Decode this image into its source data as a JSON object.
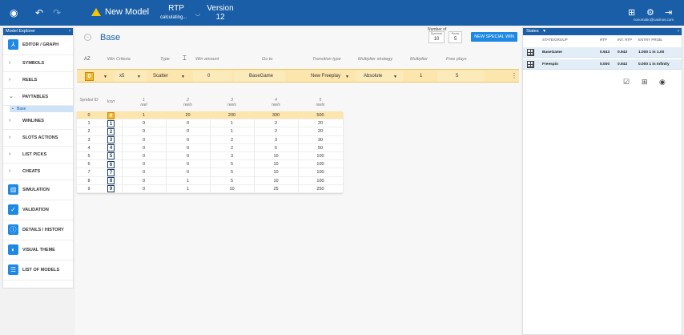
{
  "topbar": {
    "title": "New Model",
    "rtp_label": "RTP",
    "rtp_status": "calculating...",
    "version_label": "Version",
    "version_number": "12",
    "email": "novomatic@casinos.com",
    "icons": [
      "play-circle-icon",
      "undo-icon",
      "redo-icon",
      "warning-icon",
      "grid-menu-icon",
      "gear-icon",
      "logout-icon"
    ]
  },
  "sidebar": {
    "header": "Model Explorer",
    "items": [
      {
        "label": "EDITOR / GRAPH",
        "icon": "graph-icon"
      },
      {
        "label": "SYMBOLS"
      },
      {
        "label": "REELS"
      },
      {
        "label": "PAYTABLES",
        "sub": "Base"
      },
      {
        "label": "WINLINES"
      },
      {
        "label": "SLOTS ACTIONS"
      },
      {
        "label": "LIST PICKS"
      },
      {
        "label": "CHEATS"
      },
      {
        "label": "SIMULATION",
        "icon": "chart-icon"
      },
      {
        "label": "VALIDATION",
        "icon": "check-icon"
      },
      {
        "label": "DETAILS / HISTORY",
        "icon": "info-icon"
      },
      {
        "label": "VISUAL THEME",
        "icon": "palette-icon"
      },
      {
        "label": "LIST OF MODELS",
        "icon": "list-icon"
      }
    ]
  },
  "main": {
    "title": "Base",
    "number_of": "Number of",
    "symbols_caption": "Symbols",
    "symbols_value": "10",
    "reels_caption": "Reels",
    "reels_value": "5",
    "new_special_win": "NEW SPECIAL WIN",
    "rule_headers": {
      "az": "AZ",
      "win_criteria": "Win Criteria",
      "type": "Type",
      "win_amount": "Win amount",
      "go_to": "Go to",
      "transition_type": "Transition type",
      "multiplier_strategy": "Multiplier strategy",
      "multiplier": "Multiplier",
      "free_plays": "Free plays"
    },
    "rule": {
      "symbol": "0",
      "criteria": "x5",
      "type": "Scatter",
      "win_amount": "0",
      "go_to": "BaseGame",
      "transition_type": "New Freeplay",
      "multiplier_strategy": "Absolute",
      "multiplier": "1",
      "free_plays": "5"
    }
  },
  "paytable": {
    "headers": {
      "symbol_id": "Symbol ID",
      "icon": "Icon",
      "r1n": "1",
      "r1": "reel",
      "r2n": "2",
      "r2": "reels",
      "r3n": "3",
      "r3": "reels",
      "r4n": "4",
      "r4": "reels",
      "r5n": "5",
      "r5": "reels"
    },
    "rows": [
      {
        "id": "0",
        "icon": "0",
        "v": [
          "1",
          "20",
          "200",
          "300",
          "500"
        ]
      },
      {
        "id": "1",
        "icon": "1",
        "v": [
          "0",
          "0",
          "1",
          "2",
          "20"
        ]
      },
      {
        "id": "2",
        "icon": "2",
        "v": [
          "0",
          "0",
          "1",
          "2",
          "20"
        ]
      },
      {
        "id": "3",
        "icon": "3",
        "v": [
          "0",
          "0",
          "2",
          "3",
          "30"
        ]
      },
      {
        "id": "4",
        "icon": "4",
        "v": [
          "0",
          "0",
          "2",
          "5",
          "50"
        ]
      },
      {
        "id": "5",
        "icon": "5",
        "v": [
          "0",
          "0",
          "3",
          "10",
          "100"
        ]
      },
      {
        "id": "6",
        "icon": "6",
        "v": [
          "0",
          "0",
          "5",
          "10",
          "100"
        ]
      },
      {
        "id": "7",
        "icon": "7",
        "v": [
          "0",
          "0",
          "5",
          "10",
          "100"
        ]
      },
      {
        "id": "8",
        "icon": "8",
        "v": [
          "0",
          "1",
          "5",
          "10",
          "100"
        ]
      },
      {
        "id": "9",
        "icon": "9",
        "v": [
          "0",
          "1",
          "10",
          "25",
          "250"
        ]
      }
    ]
  },
  "states": {
    "header": "States",
    "columns": {
      "state": "STATE/GROUP",
      "rtp": "RTP",
      "int_rtp": "INT. RTP",
      "entry": "ENTRY PROB."
    },
    "rows": [
      {
        "name": "BaseGame",
        "rtp": "0.943",
        "int_rtp": "0.943",
        "entry": "1.000 1 in 1.00"
      },
      {
        "name": "Freespin",
        "rtp": "0.000",
        "int_rtp": "0.943",
        "entry": "0.000 1 in Infinity"
      }
    ]
  }
}
